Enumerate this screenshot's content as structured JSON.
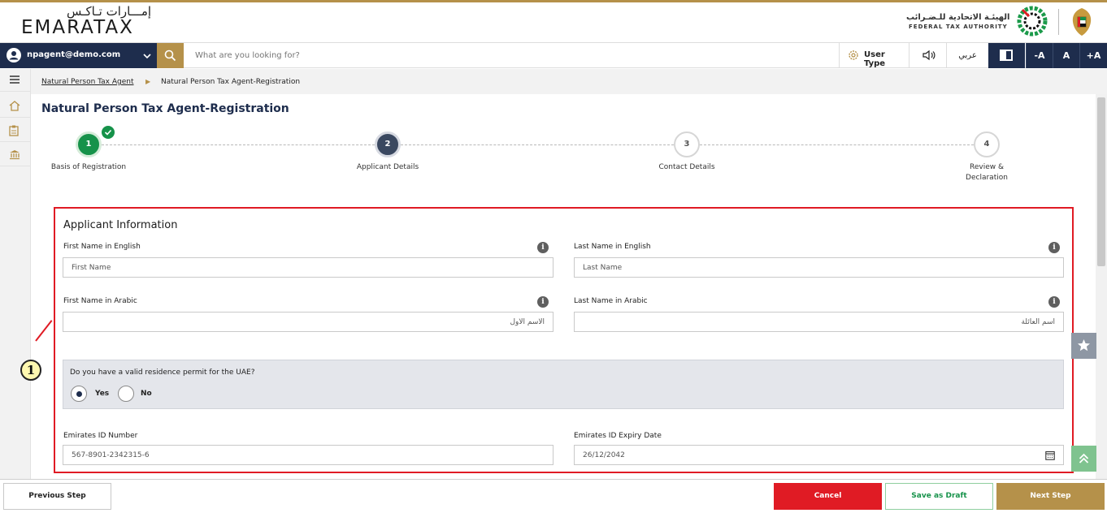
{
  "header": {
    "logo_ar": "إمـــارات تـاكـس",
    "logo_en": "EMARATAX",
    "fta_ar": "الهيئـة الاتحادية للـضـرائب",
    "fta_en": "FEDERAL TAX AUTHORITY"
  },
  "topbar": {
    "user_email": "npagent@demo.com",
    "search_placeholder": "What are you looking for?",
    "user_type": "User Type",
    "arabic": "عربي",
    "font_decrease": "-A",
    "font_normal": "A",
    "font_increase": "+A"
  },
  "breadcrumb": {
    "parent": "Natural Person Tax Agent",
    "current": "Natural Person Tax Agent-Registration"
  },
  "page_title": "Natural Person Tax Agent-Registration",
  "steps": [
    {
      "number": "1",
      "label": "Basis of Registration",
      "status": "completed"
    },
    {
      "number": "2",
      "label": "Applicant Details",
      "status": "active"
    },
    {
      "number": "3",
      "label": "Contact Details",
      "status": "pending"
    },
    {
      "number": "4",
      "label": "Review &\nDeclaration",
      "status": "pending"
    }
  ],
  "form": {
    "section_title": "Applicant Information",
    "first_name_en": {
      "label": "First Name in English",
      "placeholder": "First Name",
      "value": ""
    },
    "last_name_en": {
      "label": "Last Name in English",
      "placeholder": "Last Name",
      "value": ""
    },
    "first_name_ar": {
      "label": "First Name in Arabic",
      "value": "الاسم الأول"
    },
    "last_name_ar": {
      "label": "Last Name in Arabic",
      "value": "اسم العائلة"
    },
    "residence": {
      "question": "Do you have a valid residence permit for the UAE?",
      "yes": "Yes",
      "no": "No",
      "selected": "Yes"
    },
    "emirates_id": {
      "label": "Emirates ID Number",
      "value": "567-8901-2342315-6"
    },
    "emirates_id_expiry": {
      "label": "Emirates ID Expiry Date",
      "value": "26/12/2042"
    }
  },
  "annotation": {
    "number": "1",
    "color": "#e01b24"
  },
  "footer": {
    "previous": "Previous Step",
    "cancel": "Cancel",
    "save_draft": "Save as Draft",
    "next": "Next Step"
  },
  "colors": {
    "navy": "#1e2d4d",
    "gold": "#b5914a",
    "green": "#16924a",
    "red": "#e01b24"
  }
}
